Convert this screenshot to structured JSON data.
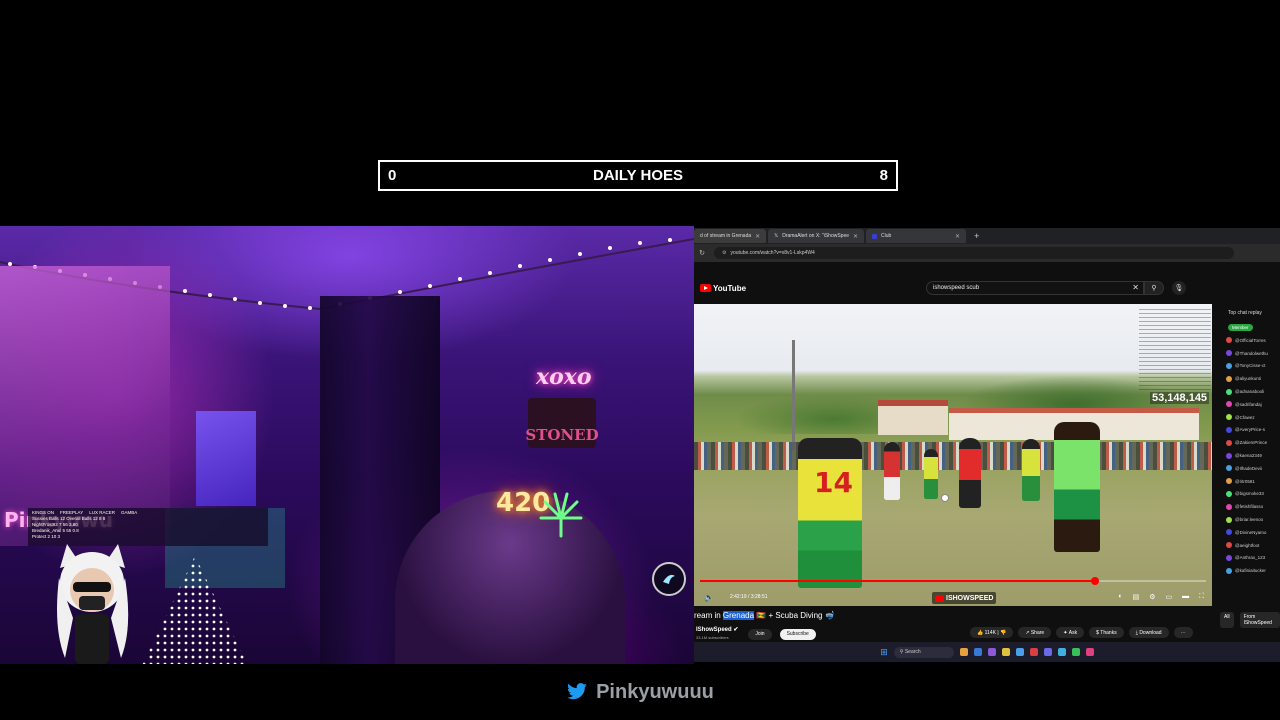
{
  "counter": {
    "left_value": "0",
    "title": "DAILY HOES",
    "right_value": "8"
  },
  "webcam": {
    "neon_sign_xoxo": "xoxo",
    "poster_sign": "STONED",
    "neon_420": "420",
    "overlay_name": "Pinkyuwu",
    "scoreboard": {
      "col1": "KINGS ON",
      "col2": "FREEPLAY",
      "col3": "LUX RACER",
      "col4": "GAMBA",
      "row1": "Sussies Balls  12   Overall Balls  12  8 8",
      "row2": "NightFrost82    7   56   3.80",
      "row3": "Bredanik_Anul   5   55   0.8",
      "row4": "Protect       2   10   3"
    },
    "accent_color": "#ff4fd2"
  },
  "browser": {
    "tabs": [
      {
        "label": "d of stream in Grenada",
        "active": true
      },
      {
        "label": "DramaAlert on X: \"iShowSpee",
        "active": false
      },
      {
        "label": "Club",
        "active": false
      }
    ],
    "url": "youtube.com/watch?v=x8v1-Lskp4W4",
    "youtube": {
      "logo_text": "YouTube",
      "search_value": "ishowspeed scub",
      "viewer_count": "53,148,145",
      "time_display": "2:42:19 / 3:28:51",
      "progress": 0.78,
      "channel_badge": "ISHOWSPEED",
      "jersey_number": "14",
      "video_title_prefix": "ream in ",
      "video_title_highlight": "Grenada",
      "video_title_suffix": " 🇬🇩 + Scuba Diving 🤿",
      "channel_name": "IShowSpeed ✔",
      "channel_subs": "33.1M subscribers",
      "join_label": "Join",
      "subscribe_label": "Subscribe",
      "likes": "114K",
      "share_label": "Share",
      "ask_label": "Ask",
      "thanks_label": "Thanks",
      "download_label": "Download",
      "chat": {
        "header": "Top chat replay",
        "member_label": "Member",
        "users": [
          "@OfficialTorres",
          "@Thandolwethu",
          "@TonyCisse-ct",
          "@aliyunkunti",
          "@adnanabooli",
          "@sadrifandaj",
          "@Cfawez",
          "@AveryPrice-s",
          "@ZakiemPrince",
          "@kaena2349",
          "@IlhadeDevii",
          "@ritr0581",
          "@bigsmoke33",
          "@fetishfilasso",
          "@briar.leenoo",
          "@DivineNyamo",
          "@aeightfoot",
          "@Anthrax_123",
          "@kafiniaitucker"
        ],
        "tab_all": "All",
        "tab_from": "From IShowSpeed"
      }
    },
    "taskbar_search": "Search"
  },
  "handle": {
    "name": "Pinkyuwuuu"
  }
}
